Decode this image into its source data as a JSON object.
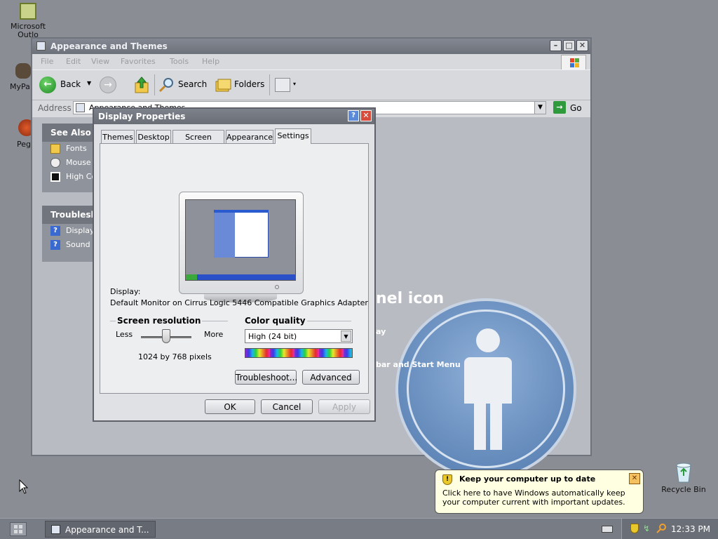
{
  "desktop": {
    "icons": [
      {
        "label": "Microsoft Outlo"
      },
      {
        "label": "MyPa"
      },
      {
        "label": "Peg"
      },
      {
        "label": "Recycle Bin"
      }
    ]
  },
  "explorer": {
    "title": "Appearance and Themes",
    "menu": [
      "File",
      "Edit",
      "View",
      "Favorites",
      "Tools",
      "Help"
    ],
    "toolbar": {
      "back": "Back",
      "search": "Search",
      "folders": "Folders"
    },
    "address": {
      "label": "Address",
      "value": "Appearance and Themes",
      "go": "Go"
    },
    "see_also": {
      "header": "See Also",
      "items": [
        "Fonts",
        "Mouse I",
        "High Co"
      ]
    },
    "troubleshooters": {
      "header": "Troubleshe",
      "items": [
        "Display",
        "Sound"
      ]
    },
    "background_text": {
      "heading": "nel icon",
      "line1": "ay",
      "line2": "bar and Start Menu"
    }
  },
  "dialog": {
    "title": "Display Properties",
    "tabs": [
      "Themes",
      "Desktop",
      "Screen Saver",
      "Appearance",
      "Settings"
    ],
    "active_tab": "Settings",
    "display_label": "Display:",
    "display_value": "Default Monitor on Cirrus Logic 5446 Compatible Graphics Adapter",
    "resolution": {
      "header": "Screen resolution",
      "less": "Less",
      "more": "More",
      "value": "1024 by 768 pixels",
      "slider_position": 0.5
    },
    "color_quality": {
      "header": "Color quality",
      "selected": "High (24 bit)"
    },
    "buttons": {
      "troubleshoot": "Troubleshoot...",
      "advanced": "Advanced",
      "ok": "OK",
      "cancel": "Cancel",
      "apply": "Apply"
    }
  },
  "balloon": {
    "title": "Keep your computer up to date",
    "body": "Click here to have Windows automatically keep your computer current with important updates."
  },
  "taskbar": {
    "task": "Appearance and T...",
    "clock": "12:33 PM"
  },
  "colors": {
    "desktop": "#8a8d94",
    "titlebar": "#6d717a",
    "balloon": "#ffffe1",
    "go_green": "#2f9a3b"
  }
}
